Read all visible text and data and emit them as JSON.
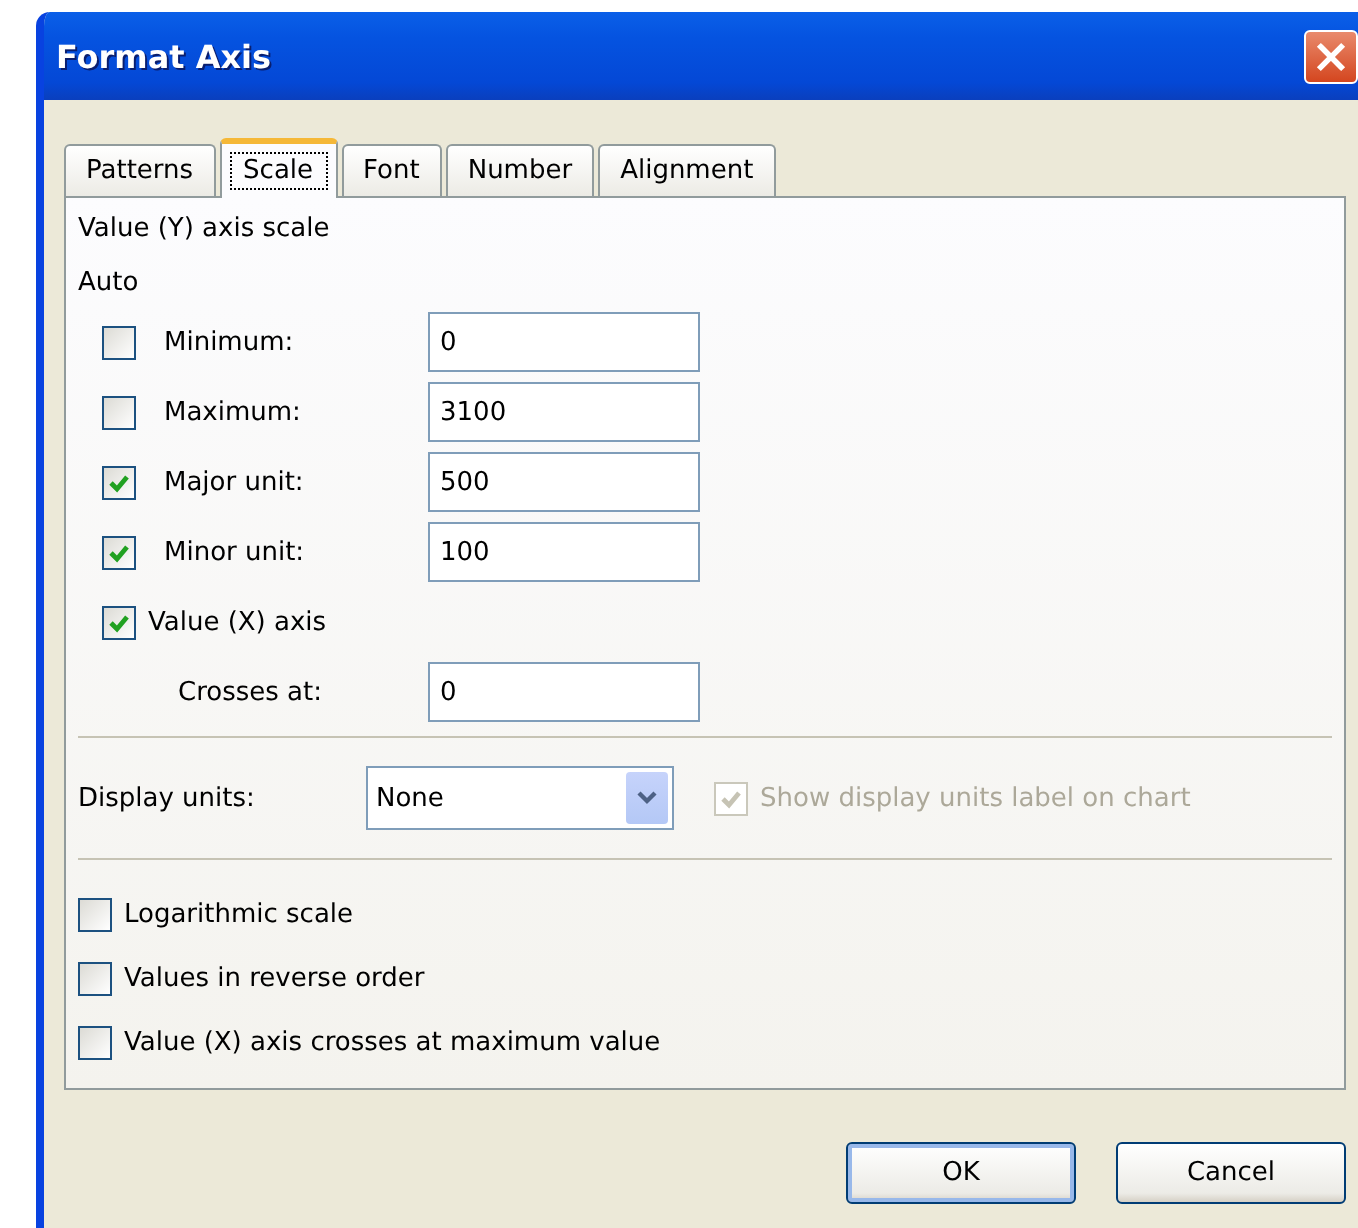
{
  "window": {
    "title": "Format Axis"
  },
  "tabs": [
    {
      "label": "Patterns",
      "selected": false
    },
    {
      "label": "Scale",
      "selected": true
    },
    {
      "label": "Font",
      "selected": false
    },
    {
      "label": "Number",
      "selected": false
    },
    {
      "label": "Alignment",
      "selected": false
    }
  ],
  "scale": {
    "heading": "Value (Y) axis scale",
    "auto_label": "Auto",
    "rows": [
      {
        "kind": "field",
        "label": "Minimum:",
        "checked": false,
        "value": "0"
      },
      {
        "kind": "field",
        "label": "Maximum:",
        "checked": false,
        "value": "3100"
      },
      {
        "kind": "field",
        "label": "Major unit:",
        "checked": true,
        "value": "500"
      },
      {
        "kind": "field",
        "label": "Minor unit:",
        "checked": true,
        "value": "100"
      },
      {
        "kind": "check",
        "label": "Value (X) axis",
        "checked": true
      },
      {
        "kind": "plain",
        "label": "Crosses at:",
        "value": "0"
      }
    ],
    "display_units": {
      "label": "Display units:",
      "value": "None"
    },
    "show_label": {
      "label": "Show display units label on chart",
      "checked": true,
      "disabled": true
    },
    "options": [
      {
        "label": "Logarithmic scale",
        "checked": false
      },
      {
        "label": "Values in reverse order",
        "checked": false
      },
      {
        "label": "Value (X) axis crosses at maximum value",
        "checked": false
      }
    ]
  },
  "buttons": [
    "OK",
    "Cancel"
  ]
}
